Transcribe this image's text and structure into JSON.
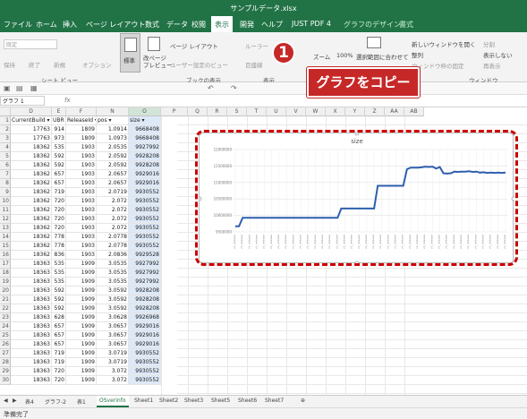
{
  "window": {
    "title": "サンプルデータ.xlsx"
  },
  "menu": [
    "ファイル",
    "ホーム",
    "挿入",
    "ページ レイアウト",
    "数式",
    "データ",
    "校閲",
    "表示",
    "開発",
    "ヘルプ",
    "JUST PDF 4",
    "グラフのデザイン",
    "書式"
  ],
  "menu_active": "表示",
  "ribbon": {
    "sheet_view_dropdown": "既定",
    "keep": "保持",
    "exit": "終了",
    "new": "新規",
    "options": "オプション",
    "group_sheet_view": "シート ビュー",
    "normal": "標準",
    "page_break": "改ページ\nプレビュー",
    "page_layout": "ページ レイアウト",
    "user_view": "ユーザー設定のビュー",
    "group_book_view": "ブックの表示",
    "ruler": "ルーラー",
    "gridlines": "目盛線",
    "group_show": "表示",
    "zoom": "ズーム",
    "zoom_100": "100%",
    "zoom_selection": "選択範囲に合わせて",
    "new_window": "新しいウィンドウを開く",
    "arrange": "整列",
    "freeze": "ウィンドウ枠の固定",
    "split": "分割",
    "hide": "表示しない",
    "unhide": "再表示",
    "group_window": "ウィンドウ"
  },
  "name_box": "グラフ 1",
  "fx_label": "fx",
  "columns": [
    "D",
    "E",
    "F",
    "N",
    "O",
    "P",
    "Q",
    "R",
    "S",
    "T",
    "U",
    "V",
    "W",
    "X",
    "Y",
    "Z",
    "AA",
    "AB"
  ],
  "header_row": [
    "CurrentBuild",
    "UBR",
    "ReleaseId",
    "pos",
    "size"
  ],
  "rows": [
    [
      "17763",
      "914",
      "1809",
      "1.0914",
      "9668408"
    ],
    [
      "17763",
      "973",
      "1809",
      "1.0973",
      "9668408"
    ],
    [
      "18362",
      "535",
      "1903",
      "2.0535",
      "9927992"
    ],
    [
      "18362",
      "592",
      "1903",
      "2.0592",
      "9928208"
    ],
    [
      "18362",
      "592",
      "1903",
      "2.0592",
      "9928208"
    ],
    [
      "18362",
      "657",
      "1903",
      "2.0657",
      "9929016"
    ],
    [
      "18362",
      "657",
      "1903",
      "2.0657",
      "9929016"
    ],
    [
      "18362",
      "719",
      "1903",
      "2.0719",
      "9930552"
    ],
    [
      "18362",
      "720",
      "1903",
      "2.072",
      "9930552"
    ],
    [
      "18362",
      "720",
      "1903",
      "2.072",
      "9930552"
    ],
    [
      "18362",
      "720",
      "1903",
      "2.072",
      "9930552"
    ],
    [
      "18362",
      "720",
      "1903",
      "2.072",
      "9930552"
    ],
    [
      "18362",
      "778",
      "1903",
      "2.0778",
      "9930552"
    ],
    [
      "18362",
      "778",
      "1903",
      "2.0778",
      "9930552"
    ],
    [
      "18362",
      "836",
      "1903",
      "2.0836",
      "9929528"
    ],
    [
      "18363",
      "535",
      "1909",
      "3.0535",
      "9927992"
    ],
    [
      "18363",
      "535",
      "1909",
      "3.0535",
      "9927992"
    ],
    [
      "18363",
      "535",
      "1909",
      "3.0535",
      "9927992"
    ],
    [
      "18363",
      "592",
      "1909",
      "3.0592",
      "9928208"
    ],
    [
      "18363",
      "592",
      "1909",
      "3.0592",
      "9928208"
    ],
    [
      "18363",
      "592",
      "1909",
      "3.0592",
      "9928208"
    ],
    [
      "18363",
      "628",
      "1909",
      "3.0628",
      "9926968"
    ],
    [
      "18363",
      "657",
      "1909",
      "3.0657",
      "9929016"
    ],
    [
      "18363",
      "657",
      "1909",
      "3.0657",
      "9929016"
    ],
    [
      "18363",
      "657",
      "1909",
      "3.0657",
      "9929016"
    ],
    [
      "18363",
      "719",
      "1909",
      "3.0719",
      "9930552"
    ],
    [
      "18363",
      "719",
      "1909",
      "3.0719",
      "9930552"
    ],
    [
      "18363",
      "720",
      "1909",
      "3.072",
      "9930552"
    ],
    [
      "18363",
      "720",
      "1909",
      "3.072",
      "9930552"
    ]
  ],
  "sheet_tabs": [
    "表4",
    "グラフ-2",
    "表1",
    "OSverinfo",
    "Sheet1",
    "Sheet2",
    "Sheet3",
    "Sheet5",
    "Sheet6",
    "Sheet7"
  ],
  "sheet_tab_active": "OSverinfo",
  "status_text": "準備完了",
  "callout": {
    "number": "1",
    "text": "グラフをコピー"
  },
  "colors": {
    "excel_green": "#217346",
    "accent_red": "#c62828",
    "series_blue": "#2e5fad"
  },
  "chart_data": {
    "type": "line",
    "title": "size",
    "ylim": [
      9500000,
      12000000
    ],
    "yticks": [
      "12000000",
      "11500000",
      "11000000",
      "10500000",
      "10000000",
      "9500000"
    ],
    "grid": true,
    "x_tick_text": "v1_release",
    "series": [
      {
        "values": [
          9668408,
          9668408,
          9927992,
          9928208,
          9928208,
          9929016,
          9929016,
          9930552,
          9930552,
          9930552,
          9930552,
          9930552,
          9930552,
          9930552,
          9929528,
          9927992,
          9927992,
          9927992,
          9928208,
          9928208,
          9928208,
          9926968,
          9929016,
          9929016,
          9929016,
          9930552,
          9930552,
          9930552,
          9930552,
          10210000,
          10210000,
          10210000,
          10210000,
          10210000,
          10210000,
          10210000,
          10210000,
          10210000,
          10210000,
          10900000,
          10900000,
          10900000,
          10900000,
          10900000,
          10900000,
          10900000,
          10900000,
          11400000,
          11450000,
          11450000,
          11450000,
          11460000,
          11480000,
          11470000,
          11480000,
          11420000,
          11470000,
          11280000,
          11270000,
          11280000,
          11330000,
          11320000,
          11330000,
          11330000,
          11340000,
          11320000,
          11330000,
          11300000,
          11310000,
          11290000,
          11300000,
          11290000,
          11300000,
          11290000,
          11300000
        ]
      }
    ]
  }
}
